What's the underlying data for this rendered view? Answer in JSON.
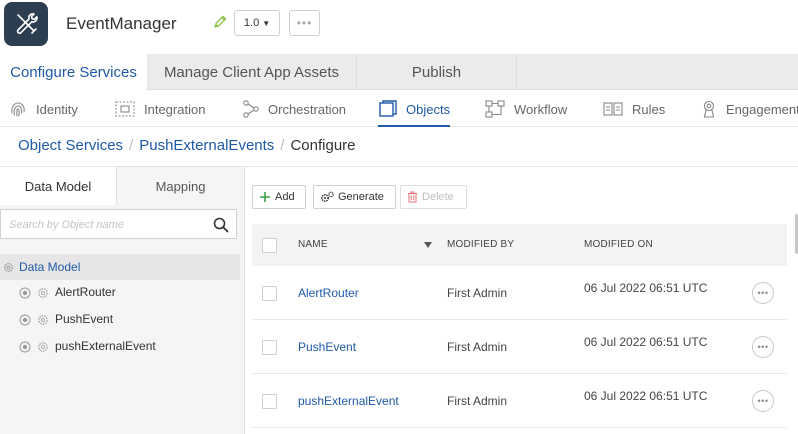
{
  "header": {
    "app_name": "EventManager",
    "version": "1.0",
    "more_label": "•••"
  },
  "top_tabs": [
    {
      "label": "Configure Services",
      "active": true
    },
    {
      "label": "Manage Client App Assets",
      "active": false
    },
    {
      "label": "Publish",
      "active": false
    }
  ],
  "sec_nav": [
    {
      "label": "Identity",
      "icon": "fingerprint-icon"
    },
    {
      "label": "Integration",
      "icon": "integration-icon"
    },
    {
      "label": "Orchestration",
      "icon": "orchestration-icon"
    },
    {
      "label": "Objects",
      "icon": "objects-icon",
      "active": true
    },
    {
      "label": "Workflow",
      "icon": "workflow-icon"
    },
    {
      "label": "Rules",
      "icon": "rules-icon"
    },
    {
      "label": "Engagement",
      "icon": "engagement-icon"
    }
  ],
  "breadcrumb": {
    "items": [
      "Object Services",
      "PushExternalEvents",
      "Configure"
    ],
    "separator": "/"
  },
  "left_panel": {
    "tabs": [
      "Data Model",
      "Mapping"
    ],
    "search_placeholder": "Search by Object name",
    "tree_root": "Data Model",
    "tree_items": [
      "AlertRouter",
      "PushEvent",
      "pushExternalEvent"
    ]
  },
  "toolbar": {
    "add_label": "Add",
    "generate_label": "Generate",
    "delete_label": "Delete"
  },
  "table": {
    "columns": [
      "NAME",
      "MODIFIED BY",
      "MODIFIED ON"
    ],
    "rows": [
      {
        "name": "AlertRouter",
        "modified_by": "First Admin",
        "modified_on": "06 Jul 2022 06:51 UTC"
      },
      {
        "name": "PushEvent",
        "modified_by": "First Admin",
        "modified_on": "06 Jul 2022 06:51 UTC"
      },
      {
        "name": "pushExternalEvent",
        "modified_by": "First Admin",
        "modified_on": "06 Jul 2022 06:51 UTC"
      }
    ],
    "row_more_label": "•••"
  },
  "colors": {
    "accent": "#1e5aa8",
    "logo_bg": "#2d3e50",
    "add_green": "#3aa34a",
    "edit_green": "#8bc34a",
    "delete_red": "#e57373"
  }
}
